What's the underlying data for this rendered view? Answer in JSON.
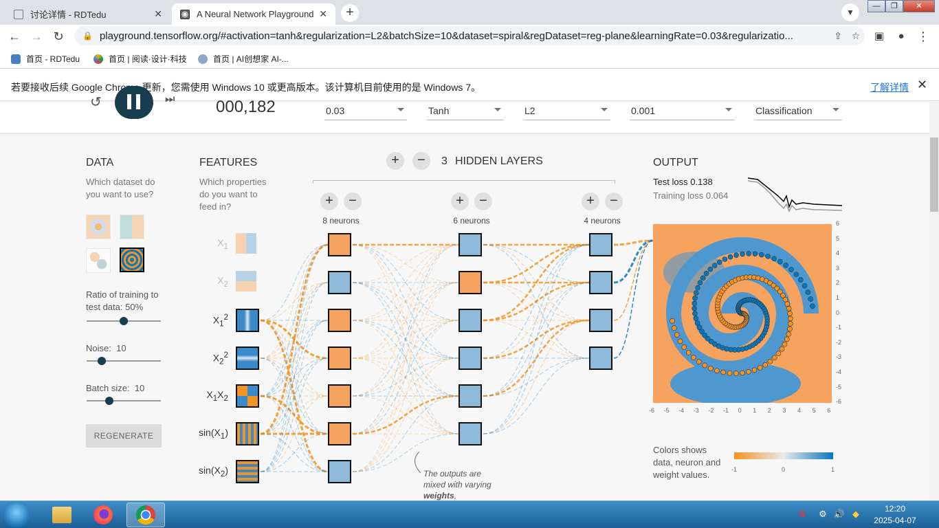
{
  "browser": {
    "tabs": [
      {
        "label": "讨论详情 - RDTedu",
        "active": false
      },
      {
        "label": "A Neural Network Playground",
        "active": true
      }
    ],
    "url": "playground.tensorflow.org/#activation=tanh&regularization=L2&batchSize=10&dataset=spiral&regDataset=reg-plane&learningRate=0.03&regularizatio...",
    "bookmarks": [
      "首页 - RDTedu",
      "首页 | 阅读·设计·科技",
      "首页 | AI创想家 AI-..."
    ],
    "infobar": {
      "message": "若要接收后续 Google Chrome 更新，您需使用 Windows 10 或更高版本。该计算机目前使用的是 Windows 7。",
      "link": "了解详情"
    }
  },
  "header": {
    "epoch": "000,182",
    "learning_rate": "0.03",
    "activation": "Tanh",
    "regularization": "L2",
    "regularization_rate": "0.001",
    "problem_type": "Classification"
  },
  "data_panel": {
    "title": "DATA",
    "subtitle": "Which dataset do you want to use?",
    "ratio_label": "Ratio of training to test data:",
    "ratio_value": "50%",
    "ratio": 0.5,
    "noise_label": "Noise:",
    "noise_value": "10",
    "noise": 0.2,
    "batch_label": "Batch size:",
    "batch_value": "10",
    "batch": 0.31,
    "regenerate": "REGENERATE"
  },
  "features_panel": {
    "title": "FEATURES",
    "subtitle": "Which properties do you want to feed in?"
  },
  "network": {
    "hidden_layers_count": "3",
    "hidden_layers_label": "HIDDEN LAYERS",
    "layers": [
      {
        "label": "8 neurons"
      },
      {
        "label": "6 neurons"
      },
      {
        "label": "4 neurons"
      }
    ],
    "annotation_prefix": "The outputs are mixed with varying",
    "annotation_bold": "weights",
    "annotation_suffix": ","
  },
  "output_panel": {
    "title": "OUTPUT",
    "test_loss_label": "Test loss",
    "test_loss": "0.138",
    "training_loss_label": "Training loss",
    "training_loss": "0.064",
    "legend_text": "Colors shows data, neuron and weight values.",
    "legend_min": "-1",
    "legend_mid": "0",
    "legend_max": "1",
    "y_ticks": [
      "6",
      "5",
      "4",
      "3",
      "2",
      "1",
      "0",
      "-1",
      "-2",
      "-3",
      "-4",
      "-5",
      "-6"
    ],
    "x_ticks": [
      "-6",
      "-5",
      "-4",
      "-3",
      "-2",
      "-1",
      "0",
      "1",
      "2",
      "3",
      "4",
      "5",
      "6"
    ]
  },
  "taskbar": {
    "time": "12:20",
    "date": "2025-04-07"
  },
  "colors": {
    "orange": "#f59322",
    "blue": "#0877bd",
    "header_dark": "#183d4e"
  }
}
